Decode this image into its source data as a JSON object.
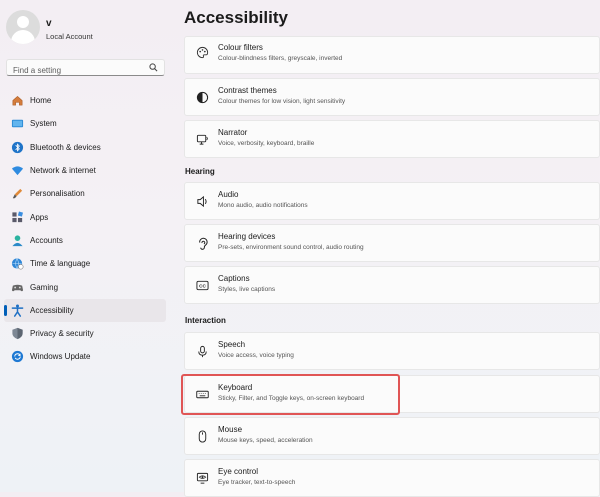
{
  "profile": {
    "name": "v",
    "account_type": "Local Account"
  },
  "search": {
    "placeholder": "Find a setting"
  },
  "nav": [
    {
      "label": "Home",
      "icon": "home-icon"
    },
    {
      "label": "System",
      "icon": "monitor-icon"
    },
    {
      "label": "Bluetooth & devices",
      "icon": "bluetooth-icon"
    },
    {
      "label": "Network & internet",
      "icon": "wifi-icon"
    },
    {
      "label": "Personalisation",
      "icon": "brush-icon"
    },
    {
      "label": "Apps",
      "icon": "apps-icon"
    },
    {
      "label": "Accounts",
      "icon": "person-icon"
    },
    {
      "label": "Time & language",
      "icon": "globe-clock-icon"
    },
    {
      "label": "Gaming",
      "icon": "gamepad-icon"
    },
    {
      "label": "Accessibility",
      "icon": "accessibility-icon",
      "active": true
    },
    {
      "label": "Privacy & security",
      "icon": "shield-icon"
    },
    {
      "label": "Windows Update",
      "icon": "update-icon"
    }
  ],
  "page": {
    "title": "Accessibility"
  },
  "sections": {
    "hearing": "Hearing",
    "interaction": "Interaction"
  },
  "cards": [
    {
      "title": "Colour filters",
      "sub": "Colour-blindness filters, greyscale, inverted",
      "icon": "palette-icon"
    },
    {
      "title": "Contrast themes",
      "sub": "Colour themes for low vision, light sensitivity",
      "icon": "contrast-icon"
    },
    {
      "title": "Narrator",
      "sub": "Voice, verbosity, keyboard, braille",
      "icon": "narrator-icon"
    },
    {
      "title": "Audio",
      "sub": "Mono audio, audio notifications",
      "icon": "speaker-icon"
    },
    {
      "title": "Hearing devices",
      "sub": "Pre-sets, environment sound control, audio routing",
      "icon": "ear-icon"
    },
    {
      "title": "Captions",
      "sub": "Styles, live captions",
      "icon": "cc-icon"
    },
    {
      "title": "Speech",
      "sub": "Voice access, voice typing",
      "icon": "microphone-icon"
    },
    {
      "title": "Keyboard",
      "sub": "Sticky, Filter, and Toggle keys, on-screen keyboard",
      "icon": "keyboard-icon"
    },
    {
      "title": "Mouse",
      "sub": "Mouse keys, speed, acceleration",
      "icon": "mouse-icon"
    },
    {
      "title": "Eye control",
      "sub": "Eye tracker, text-to-speech",
      "icon": "eye-icon"
    }
  ],
  "colors": {
    "accent": "#005fb8",
    "highlight": "#e05555"
  }
}
